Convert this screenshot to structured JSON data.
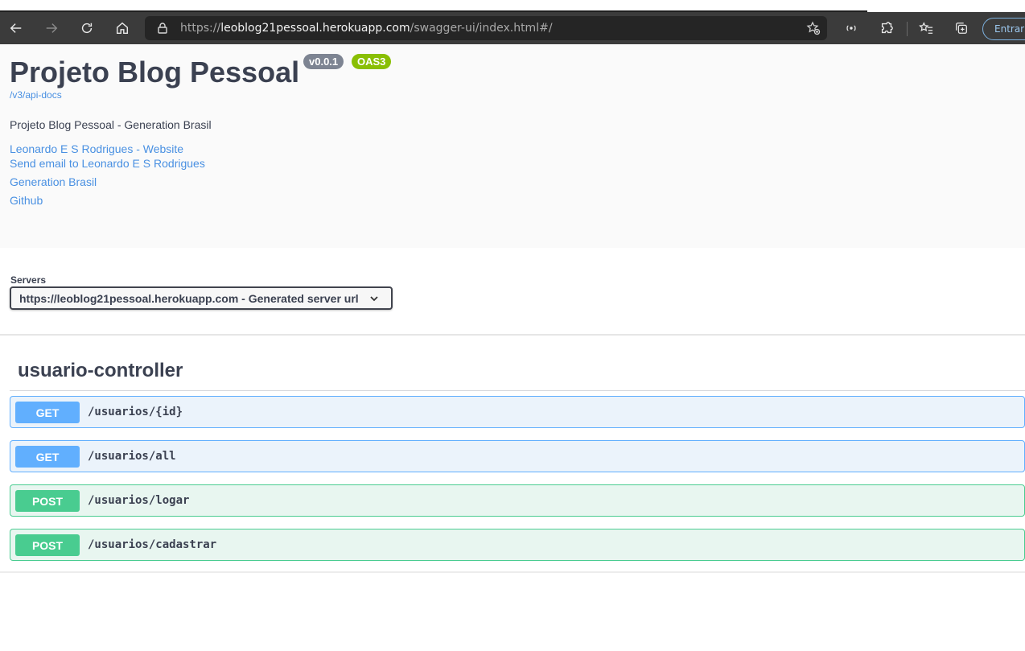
{
  "browser": {
    "url_prefix": "https://",
    "url_host": "leoblog21pessoal.herokuapp.com",
    "url_path": "/swagger-ui/index.html#/",
    "signin_label": "Entrar"
  },
  "info": {
    "title": "Projeto Blog Pessoal",
    "version_badge": "v0.0.1",
    "oas_badge": "OAS3",
    "spec_url": "/v3/api-docs",
    "description": "Projeto Blog Pessoal - Generation Brasil",
    "links": [
      "Leonardo E S Rodrigues - Website",
      "Send email to Leonardo E S Rodrigues",
      "Generation Brasil",
      "Github"
    ]
  },
  "servers": {
    "label": "Servers",
    "selected": "https://leoblog21pessoal.herokuapp.com - Generated server url"
  },
  "tag": {
    "name": "usuario-controller",
    "operations": [
      {
        "method": "GET",
        "path": "/usuarios/{id}"
      },
      {
        "method": "GET",
        "path": "/usuarios/all"
      },
      {
        "method": "POST",
        "path": "/usuarios/logar"
      },
      {
        "method": "POST",
        "path": "/usuarios/cadastrar"
      }
    ]
  },
  "colors": {
    "get": "#61affe",
    "post": "#49cc90",
    "link": "#4990e2",
    "text": "#3b4151"
  }
}
